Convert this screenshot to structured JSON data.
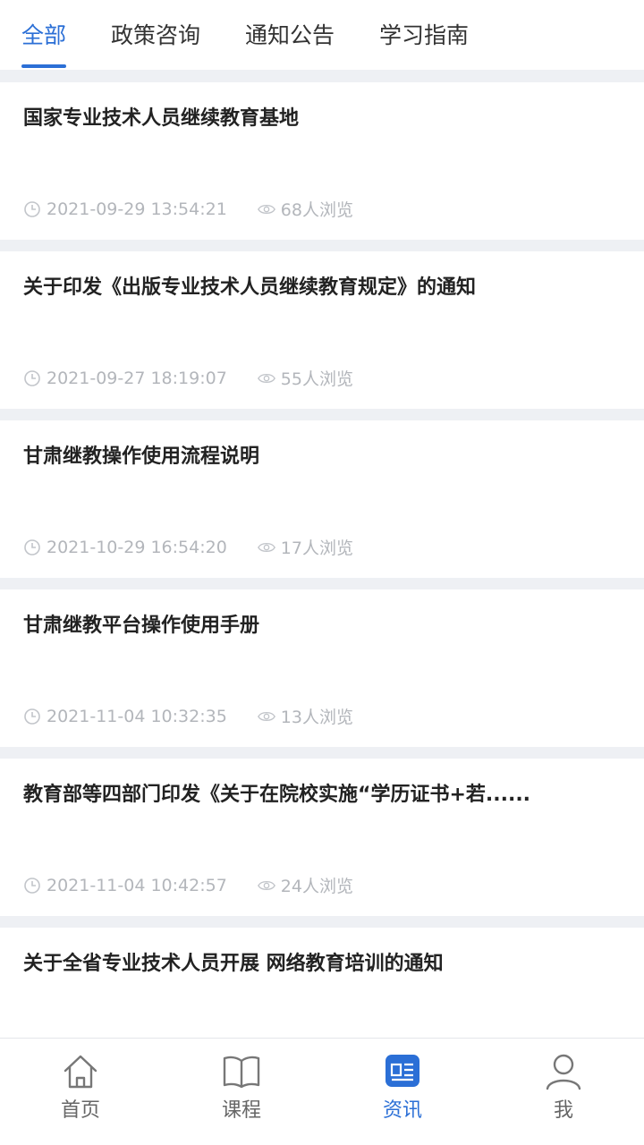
{
  "tabs": [
    "全部",
    "政策咨询",
    "通知公告",
    "学习指南"
  ],
  "active_tab": 0,
  "articles": [
    {
      "title": "国家专业技术人员继续教育基地",
      "time": "2021-09-29 13:54:21",
      "views": "68人浏览"
    },
    {
      "title": "关于印发《出版专业技术人员继续教育规定》的通知",
      "time": "2021-09-27 18:19:07",
      "views": "55人浏览"
    },
    {
      "title": "甘肃继教操作使用流程说明",
      "time": "2021-10-29 16:54:20",
      "views": "17人浏览"
    },
    {
      "title": "甘肃继教平台操作使用手册",
      "time": "2021-11-04 10:32:35",
      "views": "13人浏览"
    },
    {
      "title": "教育部等四部门印发《关于在院校实施“学历证书+若......",
      "time": "2021-11-04 10:42:57",
      "views": "24人浏览"
    },
    {
      "title": "关于全省专业技术人员开展 网络教育培训的通知",
      "time": "",
      "views": ""
    }
  ],
  "bottom_nav": [
    {
      "label": "首页",
      "icon": "home-icon"
    },
    {
      "label": "课程",
      "icon": "book-icon"
    },
    {
      "label": "资讯",
      "icon": "news-icon"
    },
    {
      "label": "我",
      "icon": "user-icon"
    }
  ],
  "active_nav": 2,
  "colors": {
    "accent": "#2b6fd6",
    "muted": "#b3b6bb"
  }
}
